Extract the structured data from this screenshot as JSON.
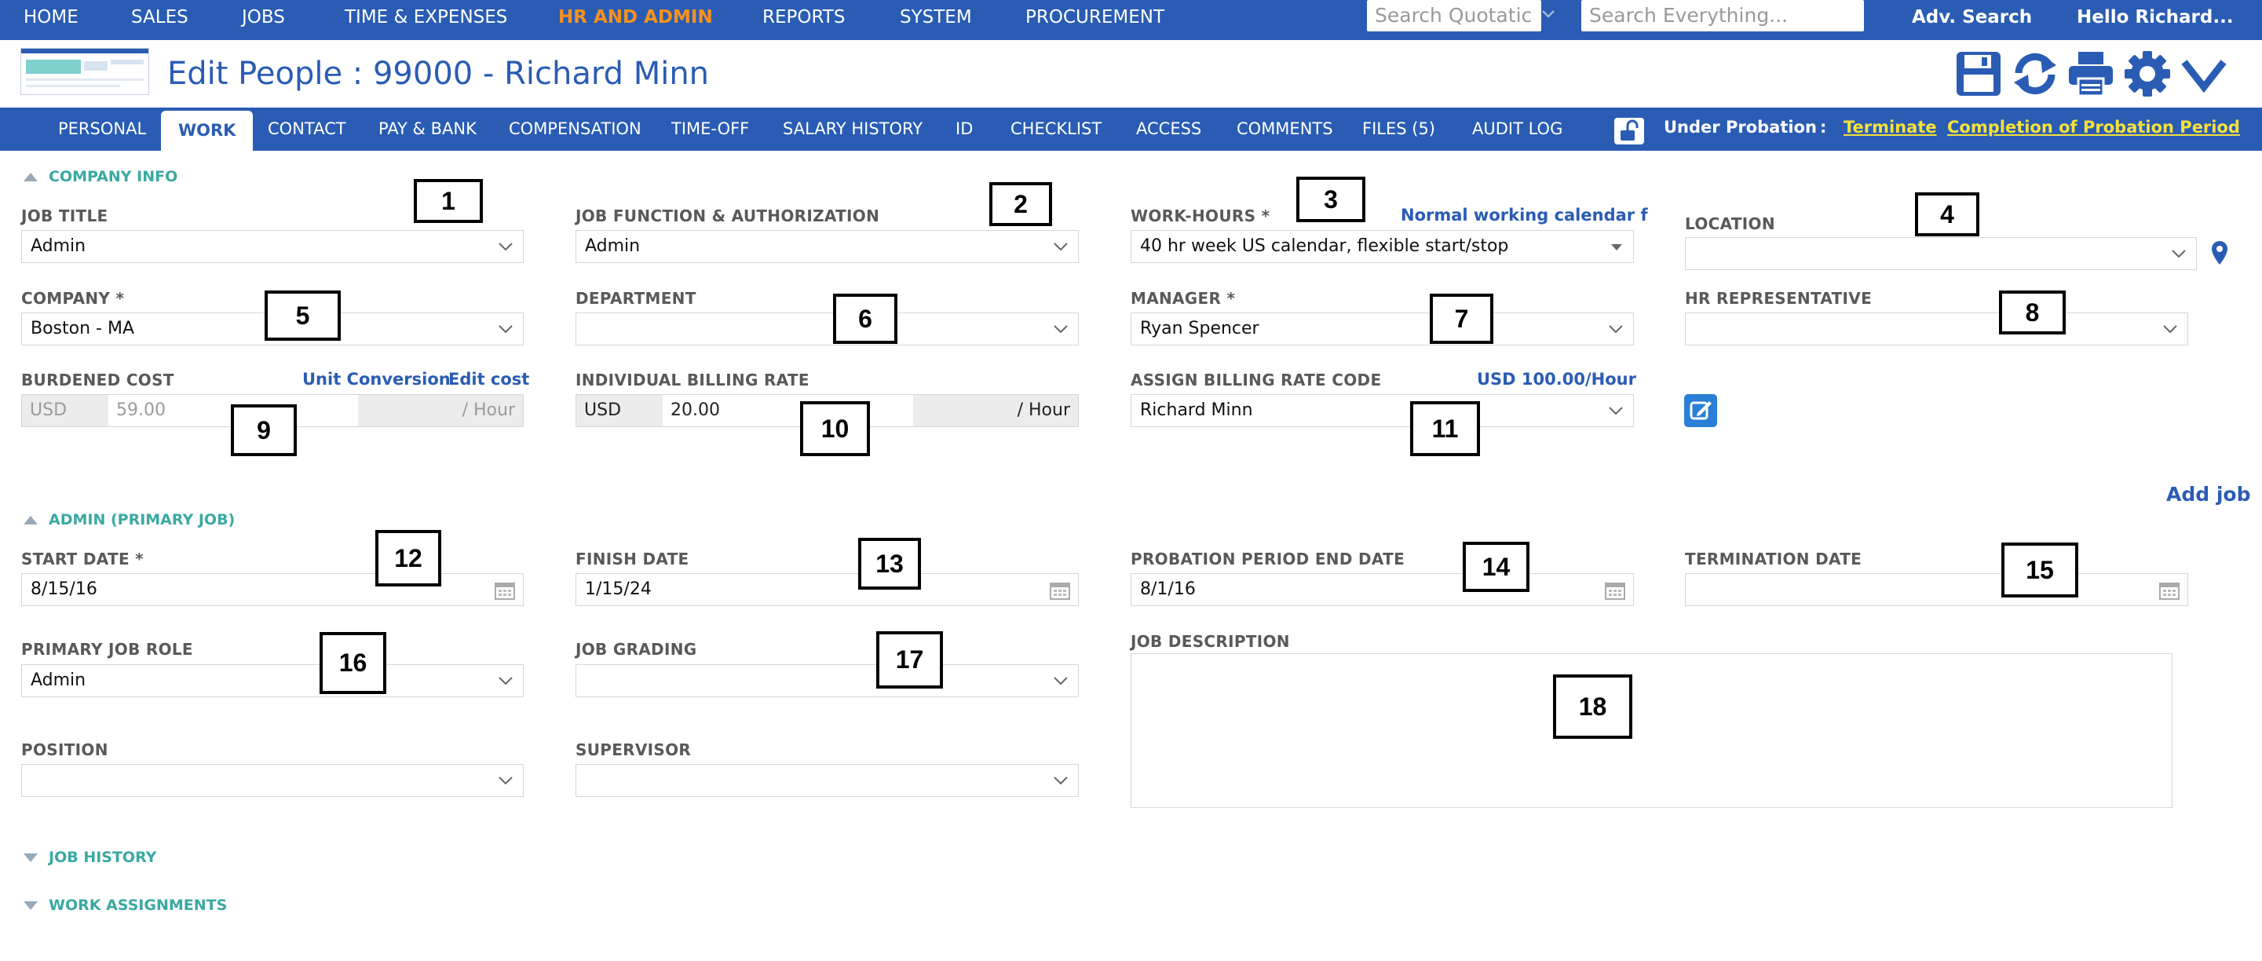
{
  "topnav": {
    "items": [
      "HOME",
      "SALES",
      "JOBS",
      "TIME & EXPENSES",
      "HR AND ADMIN",
      "REPORTS",
      "SYSTEM",
      "PROCUREMENT"
    ],
    "active": "HR AND ADMIN",
    "search_quotation_placeholder": "Search Quotatic",
    "search_everything_placeholder": "Search Everything...",
    "adv_search": "Adv. Search",
    "greeting": "Hello Richard..."
  },
  "header": {
    "title": "Edit People : 99000 - Richard Minn",
    "toolbar_icons": [
      "save-icon",
      "refresh-icon",
      "print-icon",
      "settings-gear-icon",
      "collapse-chevron-icon"
    ]
  },
  "tabs": [
    "PERSONAL",
    "WORK",
    "CONTACT",
    "PAY & BANK",
    "COMPENSATION",
    "TIME-OFF",
    "SALARY HISTORY",
    "ID",
    "CHECKLIST",
    "ACCESS",
    "COMMENTS",
    "FILES (5)",
    "AUDIT LOG"
  ],
  "active_tab": "WORK",
  "probation": {
    "status": "Under Probation",
    "separator": ":",
    "terminate_link": "Terminate",
    "completion_link": "Completion of Probation Period"
  },
  "company_info": {
    "section_title": "COMPANY INFO",
    "job_title": {
      "label": "JOB TITLE",
      "value": "Admin"
    },
    "job_function": {
      "label": "JOB FUNCTION & AUTHORIZATION",
      "value": "Admin"
    },
    "work_hours": {
      "label": "WORK-HOURS *",
      "link": "Normal working calendar f",
      "value": "40 hr week US calendar, flexible start/stop"
    },
    "location": {
      "label": "LOCATION",
      "value": ""
    },
    "company": {
      "label": "COMPANY *",
      "value": "Boston - MA"
    },
    "department": {
      "label": "DEPARTMENT",
      "value": ""
    },
    "manager": {
      "label": "MANAGER *",
      "value": "Ryan Spencer"
    },
    "hr_rep": {
      "label": "HR REPRESENTATIVE",
      "value": ""
    },
    "burdened_cost": {
      "label": "BURDENED COST",
      "link1": "Unit Conversion",
      "link2": "Edit cost",
      "currency": "USD",
      "amount": "59.00",
      "unit": "/ Hour"
    },
    "billing_rate": {
      "label": "INDIVIDUAL BILLING RATE",
      "currency": "USD",
      "amount": "20.00",
      "unit": "/ Hour"
    },
    "billing_code": {
      "label": "ASSIGN BILLING RATE CODE",
      "link": "USD 100.00/Hour",
      "value": "Richard Minn"
    }
  },
  "add_job": "Add job",
  "primary_job": {
    "section_title": "ADMIN (PRIMARY JOB)",
    "start_date": {
      "label": "START DATE *",
      "value": "8/15/16"
    },
    "finish_date": {
      "label": "FINISH DATE",
      "value": "1/15/24"
    },
    "probation_end": {
      "label": "PROBATION PERIOD END DATE",
      "value": "8/1/16"
    },
    "termination_date": {
      "label": "TERMINATION DATE",
      "value": ""
    },
    "primary_role": {
      "label": "PRIMARY JOB ROLE",
      "value": "Admin"
    },
    "job_grading": {
      "label": "JOB GRADING",
      "value": ""
    },
    "job_description": {
      "label": "JOB DESCRIPTION",
      "value": ""
    },
    "position": {
      "label": "POSITION",
      "value": ""
    },
    "supervisor": {
      "label": "SUPERVISOR",
      "value": ""
    }
  },
  "job_history": "JOB HISTORY",
  "work_assignments": "WORK ASSIGNMENTS",
  "callouts": [
    "1",
    "2",
    "3",
    "4",
    "5",
    "6",
    "7",
    "8",
    "9",
    "10",
    "11",
    "12",
    "13",
    "14",
    "15",
    "16",
    "17",
    "18"
  ],
  "colors": {
    "brand_blue": "#2a5cb4",
    "active_nav": "#f7921e",
    "section_teal": "#3aa9a2",
    "probation_link": "#f6e13a"
  }
}
